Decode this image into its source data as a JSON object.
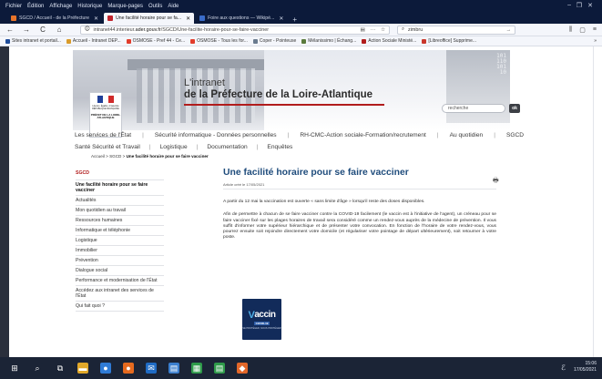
{
  "browser": {
    "menu": [
      "Fichier",
      "Édition",
      "Affichage",
      "Historique",
      "Marque-pages",
      "Outils",
      "Aide"
    ],
    "window_controls": [
      "–",
      "❐",
      "✕"
    ],
    "tabs": [
      {
        "label": "SGCD / Accueil - de la Préfecture",
        "color": "#e8742a",
        "active": false
      },
      {
        "label": "Une facilité horaire pour se fa...",
        "color": "#c0242c",
        "active": true
      },
      {
        "label": "Foire aux questions — Wikipé...",
        "color": "#3a6cc9",
        "active": false
      }
    ],
    "new_tab": "+",
    "nav": {
      "back": "←",
      "forward": "→",
      "reload": "C",
      "home": "⌂"
    },
    "url": {
      "prefix": "intranet44.interieur.",
      "host": "ader.gouv.fr",
      "path": "/SGCD/Une-facilite-horaire-pour-se-faire-vacciner"
    },
    "url_actions": [
      "▤",
      "···",
      "☆"
    ],
    "search_value": "zimbru",
    "search_go": "→",
    "right_tools": [
      "⫼",
      "▢",
      "≡"
    ],
    "bookmarks": [
      {
        "label": "Sites intranet et portail...",
        "color": "#1f4c9a"
      },
      {
        "label": "Accueil - Intranet DEP...",
        "color": "#d99b2a"
      },
      {
        "label": "OSMOSE - Pref 44 - Ce...",
        "color": "#e23c2b"
      },
      {
        "label": "OSMOSE - Tous les for...",
        "color": "#e23c2b"
      },
      {
        "label": "Coper - Pointeuse",
        "color": "#6a7b8f"
      },
      {
        "label": "Mélanissimo | Échang...",
        "color": "#5a7a3c"
      },
      {
        "label": "Action Sociale Ministé...",
        "color": "#b11c1c"
      },
      {
        "label": "[Libreoffice] Supprime...",
        "color": "#c9362b"
      }
    ],
    "bookmarks_more": "»"
  },
  "header": {
    "title_line1": "L'intranet",
    "title_line2": "de la Préfecture de la Loire-Atlantique",
    "search_placeholder": "recherche",
    "search_button": "ok",
    "logo_line1": "Liberté • Égalité • Fraternité RÉPUBLIQUE FRANÇAISE",
    "logo_line2": "PRÉFET DE LA LOIRE-ATLANTIQUE",
    "banner_numbers": "101\n110\n101\n10"
  },
  "nav_primary": [
    "Les services de l'État",
    "Sécurité informatique - Données personnelles",
    "RH-CMC-Action sociale-Formation/recrutement",
    "Au quotidien",
    "SGCD"
  ],
  "nav_secondary": [
    "Santé Sécurité et Travail",
    "Logistique",
    "Documentation",
    "Enquêtes"
  ],
  "separator": "|",
  "breadcrumb": {
    "parts": [
      "Accueil",
      "SGCD"
    ],
    "separator": " > ",
    "current": "Une facilité horaire pour se faire vacciner"
  },
  "print_icon": "🖶",
  "sidebar": {
    "heading": "SGCD",
    "items": [
      {
        "label": "Une facilité horaire pour se faire vacciner",
        "active": true
      },
      {
        "label": "Actualités",
        "active": false
      },
      {
        "label": "Mon quotidien au travail",
        "active": false
      },
      {
        "label": "Ressources humaines",
        "active": false
      },
      {
        "label": "Informatique et téléphonie",
        "active": false
      },
      {
        "label": "Logistique",
        "active": false
      },
      {
        "label": "Immobilier",
        "active": false
      },
      {
        "label": "Prévention",
        "active": false
      },
      {
        "label": "Dialogue social",
        "active": false
      },
      {
        "label": "Performance et modernisation de l'État",
        "active": false
      },
      {
        "label": "Accédez aux intranet des services de l'État",
        "active": false
      },
      {
        "label": "Qui fait quoi ?",
        "active": false
      }
    ]
  },
  "article": {
    "title": "Une facilité horaire pour se faire vacciner",
    "date": "Article créé le 17/05/2021",
    "paragraph1": "A partir du 12 mai la vaccination est ouverte « sans limite d'âge » lorsqu'il reste des doses disponibles.",
    "paragraph2": "Afin de permettre à chacun de se faire vacciner contre la COVID-19 facilement (le vaccin est à l'initiative de l'agent), un créneau pour se faire vacciner fixé sur les plages horaires de travail sera considéré comme un rendez-vous auprès de la médecine de prévention. Il vous suffit d'informer votre supérieur hiérarchique et de présenter votre convocation. En fonction de l'horaire de votre rendez-vous, vous pourrez ensuite soit rejoindre directement votre domicile (et régulariser votre pointage de départ ultérieurement), soit retourner à votre poste.",
    "vaccin_word": "accin",
    "vaccin_v": "V",
    "vaccin_sub": "COVID-19",
    "vaccin_tag": "SE PROTÉGER, NOUS PROTÉGER"
  },
  "taskbar": {
    "icons": [
      {
        "name": "windows-start-icon",
        "glyph": "⊞",
        "color": "#1b2436"
      },
      {
        "name": "search-icon",
        "glyph": "⌕",
        "color": "#1b2436"
      },
      {
        "name": "task-view-icon",
        "glyph": "⧉",
        "color": "#1b2436"
      },
      {
        "name": "explorer-icon",
        "glyph": "▬",
        "color": "#e1a82a"
      },
      {
        "name": "chrome-icon",
        "glyph": "●",
        "color": "#2f7bd6"
      },
      {
        "name": "firefox-icon",
        "glyph": "●",
        "color": "#e56a1f"
      },
      {
        "name": "outlook-icon",
        "glyph": "✉",
        "color": "#1f6bc4"
      },
      {
        "name": "notepad-icon",
        "glyph": "▤",
        "color": "#3b7fcf"
      },
      {
        "name": "calc-icon",
        "glyph": "▦",
        "color": "#2e9a4a"
      },
      {
        "name": "writer-icon",
        "glyph": "▤",
        "color": "#2e9a4a"
      },
      {
        "name": "app-icon",
        "glyph": "◆",
        "color": "#e2672a"
      }
    ],
    "time": "15:06",
    "date": "17/05/2021",
    "tray": "ℰ"
  }
}
